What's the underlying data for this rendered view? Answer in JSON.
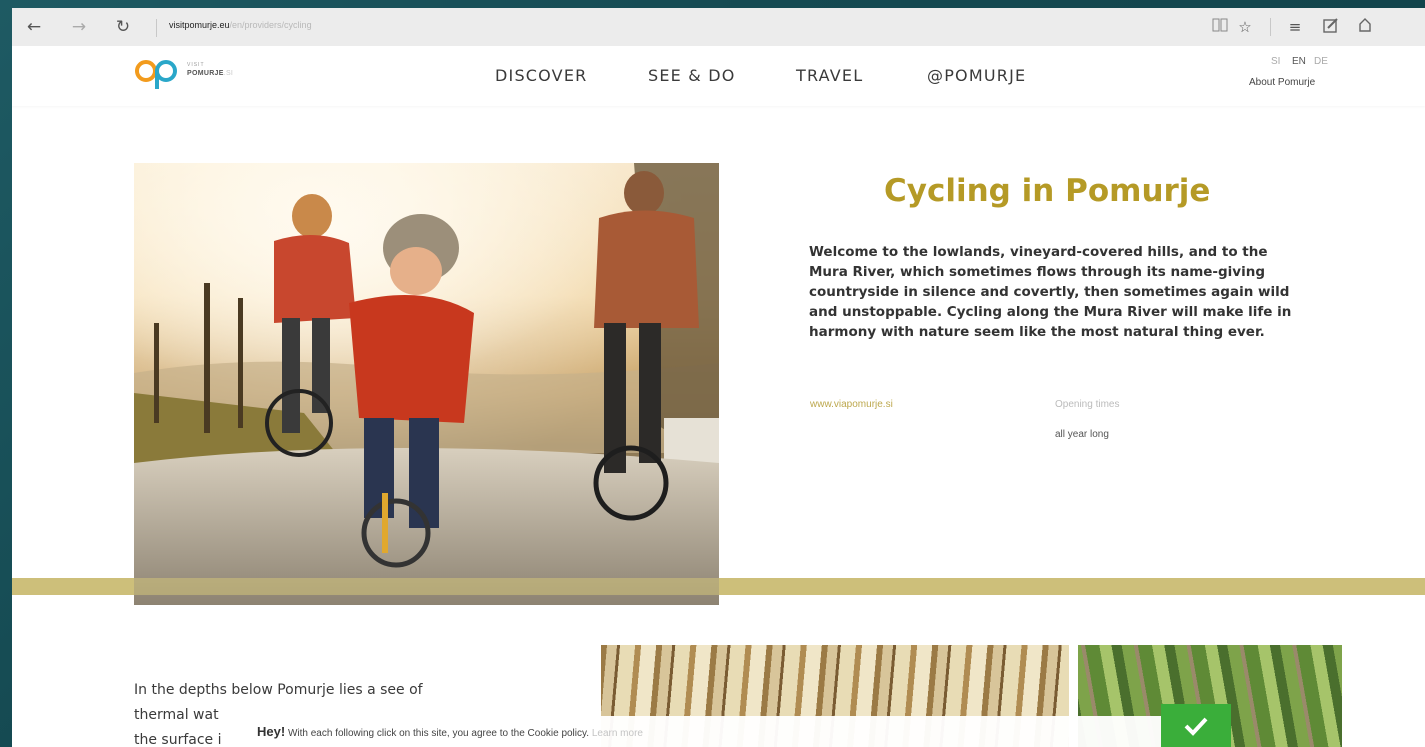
{
  "browser": {
    "back_icon": "arrow-left-icon",
    "forward_icon": "arrow-right-icon",
    "refresh_icon": "refresh-icon",
    "address_domain": "visitpomurje.eu",
    "address_path": "/en/providers/cycling",
    "toolbar_icons": [
      "reading-view-icon",
      "favorite-star-icon",
      "hub-icon",
      "web-note-icon",
      "share-icon"
    ]
  },
  "header": {
    "logo_small": "VISIT",
    "logo_name": "POMURJE",
    "logo_suffix": ".SI",
    "nav": [
      "DISCOVER",
      "SEE & DO",
      "TRAVEL",
      "@POMURJE"
    ],
    "languages": [
      "SI",
      "EN",
      "DE"
    ],
    "active_language": "EN",
    "about_link": "About Pomurje"
  },
  "hero": {
    "title": "Cycling in Pomurje",
    "description": "Welcome to the lowlands, vineyard-covered hills, and to the Mura River, which sometimes flows through its name-giving countryside in silence and covertly, then sometimes again wild and unstoppable. Cycling along the Mura River will make life in harmony with nature seem like the most natural thing ever.",
    "link": "www.viapomurje.si",
    "opening_label": "Opening times",
    "opening_value": "all year long"
  },
  "lower": {
    "lines": [
      "In the depths below Pomurje lies a see of",
      "thermal wat",
      "the surface i"
    ]
  },
  "cookie": {
    "hey": "Hey!",
    "message": " With each following click on this site, you agree to the Cookie policy. ",
    "learn_more": "Learn more",
    "accept_icon": "checkmark-icon"
  },
  "colors": {
    "accent_gold": "#b59a26",
    "band_gold": "#cdbf7a",
    "accept_green": "#3aae3a"
  }
}
